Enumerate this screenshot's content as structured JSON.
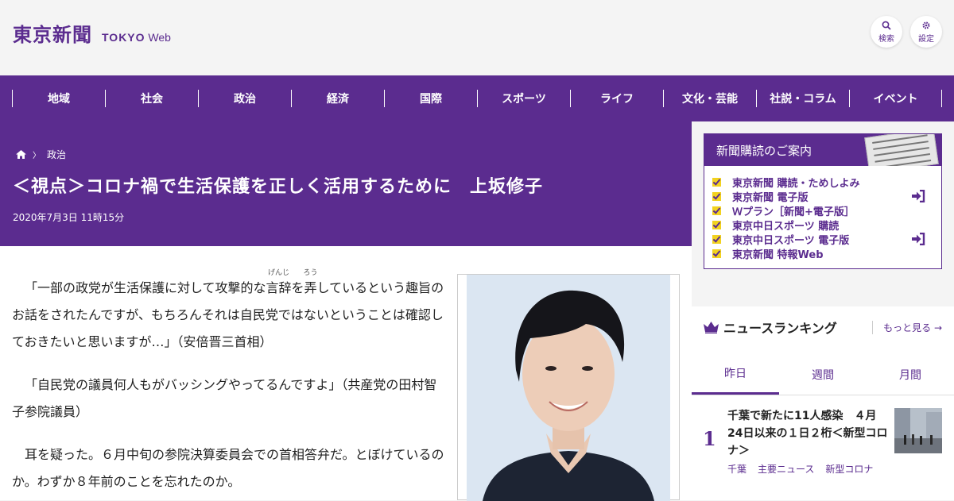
{
  "brand": {
    "name_jp": "東京新聞",
    "name_en_bold": "TOKYO",
    "name_en_light": "Web"
  },
  "header": {
    "search_label": "検索",
    "settings_label": "設定"
  },
  "nav": {
    "items": [
      "地域",
      "社会",
      "政治",
      "経済",
      "国際",
      "スポーツ",
      "ライフ",
      "文化・芸能",
      "社説・コラム",
      "イベント"
    ]
  },
  "breadcrumb": {
    "home_icon": "home-icon",
    "section": "政治"
  },
  "article": {
    "headline": "＜視点＞コロナ禍で生活保護を正しく活用するために　上坂修子",
    "date": "2020年7月3日 11時15分",
    "p1": {
      "before": "「一部の政党が生活保護に対して攻撃的な",
      "w1": "言辞",
      "r1": "げんじ",
      "mid": "を",
      "w2": "弄",
      "r2": "ろう",
      "after": "しているという趣旨のお話をされたんですが、もちろんそれは自民党ではないということは確認しておきたいと思いますが…」（安倍晋三首相）"
    },
    "p2": "「自民党の議員何人もがバッシングやってるんですよ」（共産党の田村智子参院議員）",
    "p3": "耳を疑った。６月中旬の参院決算委員会での首相答弁だ。とぼけているのか。わずか８年前のことを忘れたのか。"
  },
  "subscription": {
    "heading": "新聞購読のご案内",
    "items": [
      "東京新聞 購読・ためしよみ",
      "東京新聞 電子版",
      "Ｗプラン［新聞+電子版］",
      "東京中日スポーツ 購読",
      "東京中日スポーツ 電子版",
      "東京新聞 特報Web"
    ]
  },
  "ranking": {
    "title": "ニュースランキング",
    "more": "もっと見る",
    "tabs": [
      "昨日",
      "週間",
      "月間"
    ],
    "first": {
      "rank": "1",
      "title": "千葉で新たに11人感染　４月24日以来の１日２桁＜新型コロナ＞",
      "tags": [
        "千葉",
        "主要ニュース",
        "新型コロナ"
      ]
    }
  },
  "colors": {
    "brand_purple": "#5b2c8f",
    "check_yellow": "#f2d21f"
  }
}
